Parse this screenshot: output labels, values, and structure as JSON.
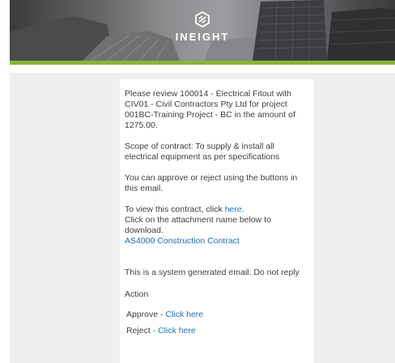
{
  "brand": {
    "name": "INEIGHT",
    "logo_icon": "ineight-mark-icon"
  },
  "colors": {
    "accent_green": "#8ab339",
    "link": "#1f6fb5",
    "text": "#404040",
    "background": "#eeeeee"
  },
  "email": {
    "review_text": "Please review 100014 - Electrical Fitout with CIV01 - Civil Contractors Pty Ltd for project 001BC-Training Project - BC in the amount of 1275.00.",
    "scope_text": "Scope of contract: To supply & install all electrical equipment as per specifications",
    "approve_reject_text": "You can approve or reject using the buttons in this email.",
    "view_prefix": "To view this contract, click ",
    "view_link": "here",
    "view_suffix": ".",
    "attachment_instruction": "Click on the attachment name below to download.",
    "attachment_name": "AS4000 Construction Contract",
    "system_note": "This is a system generated email. Do not reply",
    "action_title": "Action",
    "approve_label": "Approve - ",
    "approve_link": "Click here",
    "reject_label": "Reject - ",
    "reject_link": "Click here"
  }
}
